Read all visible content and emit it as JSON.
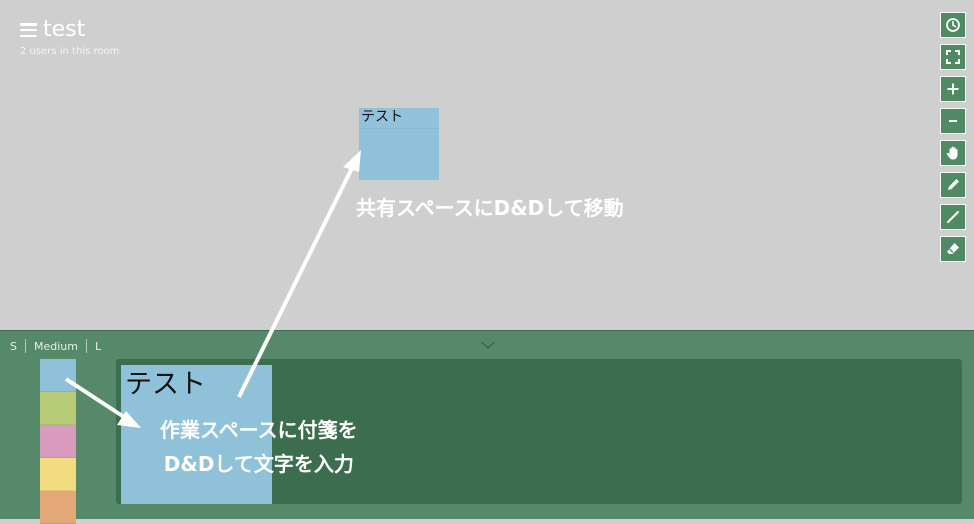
{
  "room": {
    "title": "test",
    "users": "2 users in this room"
  },
  "toolbar": [
    {
      "name": "clock-icon",
      "label": "History"
    },
    {
      "name": "fullscreen-icon",
      "label": "Fullscreen"
    },
    {
      "name": "zoom-in-icon",
      "label": "+"
    },
    {
      "name": "zoom-out-icon",
      "label": "−"
    },
    {
      "name": "hand-icon",
      "label": "Pan"
    },
    {
      "name": "pencil-icon",
      "label": "Pen"
    },
    {
      "name": "line-icon",
      "label": "Line"
    },
    {
      "name": "eraser-icon",
      "label": "Eraser"
    }
  ],
  "board": {
    "shared_note": {
      "text": "テスト",
      "color": "#8fc1d9"
    },
    "annotation": "共有スペースにD&Dして移動"
  },
  "panel": {
    "sizes": [
      "S",
      "Medium",
      "L"
    ],
    "palette": [
      "#8fc1d9",
      "#b7cb76",
      "#d89bbe",
      "#f2dc82",
      "#e2a877"
    ],
    "work_note": {
      "text": "テスト"
    },
    "annotation_line1": "作業スペースに付箋を",
    "annotation_line2": "D&Dして文字を入力"
  },
  "colors": {
    "board_bg": "#cfcfcf",
    "panel_bg": "#56896a",
    "workspace_bg": "#3c6d4e",
    "accent": "#4f8a63"
  }
}
